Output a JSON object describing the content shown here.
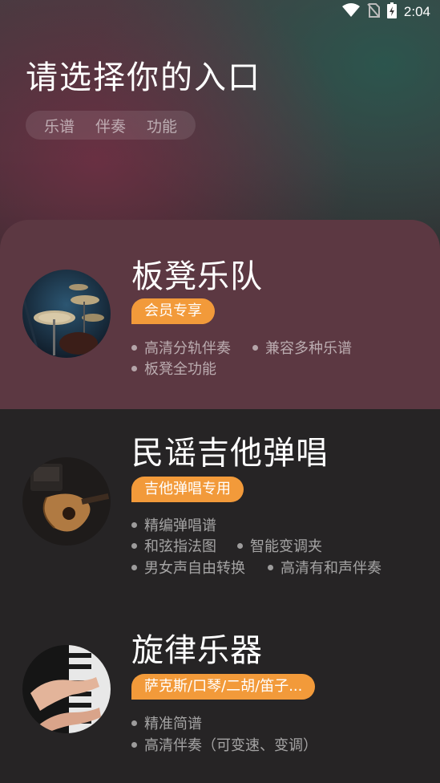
{
  "status_bar": {
    "time": "2:04"
  },
  "header": {
    "title": "请选择你的入口",
    "tabs": [
      "乐谱",
      "伴奏",
      "功能"
    ]
  },
  "cards": [
    {
      "title": "板凳乐队",
      "tag": "会员专享",
      "features": [
        "高清分轨伴奏",
        "兼容多种乐谱",
        "板凳全功能"
      ],
      "image": "drum-kit-photo"
    },
    {
      "title": "民谣吉他弹唱",
      "tag": "吉他弹唱专用",
      "features": [
        "精编弹唱谱",
        "和弦指法图",
        "智能变调夹",
        "男女声自由转换",
        "高清有和声伴奏"
      ],
      "image": "acoustic-guitar-photo"
    },
    {
      "title": "旋律乐器",
      "tag": "萨克斯/口琴/二胡/笛子...",
      "features": [
        "精准简谱",
        "高清伴奏（可变速、变调）"
      ],
      "image": "piano-hands-photo"
    }
  ],
  "colors": {
    "accent": "#f29a3a",
    "member_card_bg": "#5c3842",
    "card_bg": "#262425"
  }
}
